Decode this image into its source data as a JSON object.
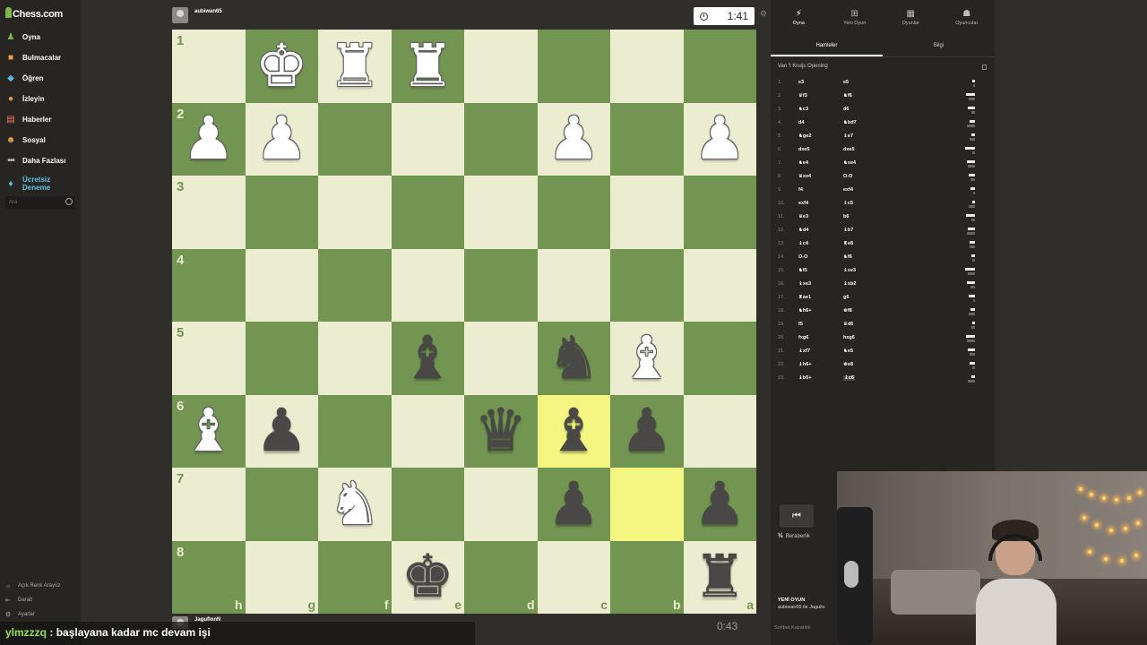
{
  "sidebar": {
    "logo": "Chess.com",
    "items": [
      {
        "label": "Oyna",
        "icon": "play-icon"
      },
      {
        "label": "Bulmacalar",
        "icon": "puzzle-icon"
      },
      {
        "label": "Öğren",
        "icon": "learn-icon"
      },
      {
        "label": "İzleyin",
        "icon": "watch-icon"
      },
      {
        "label": "Haberler",
        "icon": "news-icon"
      },
      {
        "label": "Sosyal",
        "icon": "social-icon"
      },
      {
        "label": "Daha Fazlası",
        "icon": "more-icon"
      }
    ],
    "trial_line1": "Ücretsiz",
    "trial_line2": "Deneme",
    "search_placeholder": "Ara",
    "bottom": [
      {
        "label": "Açık Renk Arayüz"
      },
      {
        "label": "Daralt"
      },
      {
        "label": "Ayarlar"
      }
    ]
  },
  "top_player": {
    "name": "aubiwan65",
    "clock": "1:41"
  },
  "bottom_player": {
    "name": "JaguflonN",
    "clock": "0:43"
  },
  "board": {
    "colors": {
      "light": "#ebecd0",
      "dark": "#739552",
      "highlight": "#f5f682"
    },
    "ranks": [
      "1",
      "2",
      "3",
      "4",
      "5",
      "6",
      "7",
      "8"
    ],
    "files": [
      "h",
      "g",
      "f",
      "e",
      "d",
      "c",
      "b",
      "a"
    ],
    "pieces": [
      "",
      "wK",
      "wR",
      "wR",
      "",
      "",
      "",
      "",
      "wP",
      "wP",
      "",
      "",
      "",
      "wP",
      "",
      "wP",
      "",
      "",
      "",
      "",
      "",
      "",
      "",
      "",
      "",
      "",
      "",
      "",
      "",
      "",
      "",
      "",
      "",
      "",
      "",
      "bB",
      "",
      "bN",
      "wB",
      "",
      "wB",
      "bP",
      "",
      "",
      "bQ",
      "bB",
      "bP",
      "",
      "",
      "",
      "wN",
      "",
      "",
      "bP",
      "",
      "bP",
      "",
      "",
      "",
      "bK",
      "",
      "",
      "",
      "bR"
    ],
    "highlights": [
      [
        5,
        5
      ],
      [
        6,
        6
      ]
    ]
  },
  "right_panel": {
    "tabs": [
      {
        "label": "Oyna",
        "icon": "bolt-icon"
      },
      {
        "label": "Yeni Oyun",
        "icon": "plus-icon"
      },
      {
        "label": "Oyunlar",
        "icon": "grid-icon"
      },
      {
        "label": "Oyuncular",
        "icon": "players-icon"
      }
    ],
    "subtabs": [
      "Hamleler",
      "Bilgi"
    ],
    "opening": "Van 't Kruijs Opening",
    "moves": [
      {
        "n": "1.",
        "w": "e3",
        "b": "e5"
      },
      {
        "n": "2.",
        "w": "♛f3",
        "b": "♞f6"
      },
      {
        "n": "3.",
        "w": "♞c3",
        "b": "d6"
      },
      {
        "n": "4.",
        "w": "d4",
        "b": "♞bd7"
      },
      {
        "n": "5.",
        "w": "♞ge2",
        "b": "♝e7"
      },
      {
        "n": "6.",
        "w": "dxe5",
        "b": "dxe5"
      },
      {
        "n": "7.",
        "w": "♞e4",
        "b": "♞xe4"
      },
      {
        "n": "8.",
        "w": "♛xe4",
        "b": "O-O"
      },
      {
        "n": "9.",
        "w": "f4",
        "b": "exf4"
      },
      {
        "n": "10.",
        "w": "exf4",
        "b": "♝c5"
      },
      {
        "n": "11.",
        "w": "♛e3",
        "b": "b6"
      },
      {
        "n": "12.",
        "w": "♞d4",
        "b": "♝b7"
      },
      {
        "n": "13.",
        "w": "♝c4",
        "b": "♜e8"
      },
      {
        "n": "14.",
        "w": "O-O",
        "b": "♞f6"
      },
      {
        "n": "15.",
        "w": "♞f5",
        "b": "♝xe3"
      },
      {
        "n": "16.",
        "w": "♝xe3",
        "b": "♝xb2"
      },
      {
        "n": "17.",
        "w": "♜ae1",
        "b": "g6"
      },
      {
        "n": "18.",
        "w": "♞h6+",
        "b": "♚f8"
      },
      {
        "n": "19.",
        "w": "f5",
        "b": "♛d6"
      },
      {
        "n": "20.",
        "w": "fxg6",
        "b": "hxg6"
      },
      {
        "n": "21.",
        "w": "♝xf7",
        "b": "♞e5"
      },
      {
        "n": "22.",
        "w": "♝h6+",
        "b": "♚e8"
      },
      {
        "n": "23.",
        "w": "♝b5+",
        "b": "♝c6"
      }
    ],
    "draw_symbol": "½",
    "draw_label": "Beraberlik",
    "new_game_title": "YENİ OYUN",
    "new_game_sub": "aubiwan65 ile Jagulio",
    "chat_note": "Sohbet Kapatıldı"
  },
  "overlay_chat": {
    "user": "ylmzzzq",
    "message": ": başlayana kadar mc devam işi"
  }
}
